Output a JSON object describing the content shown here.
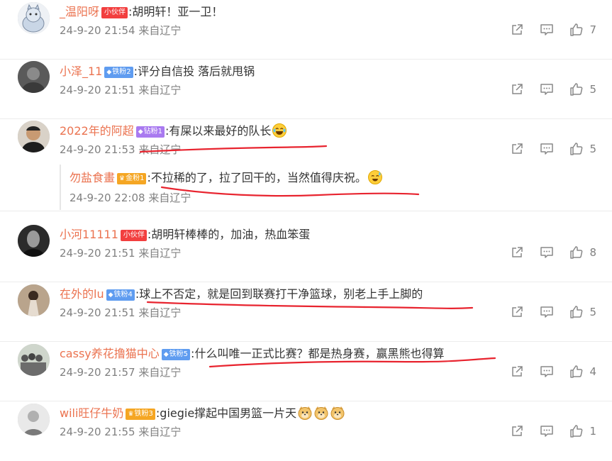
{
  "comments": [
    {
      "username": "_温阳呀",
      "badge": {
        "label": "小伙伴",
        "color": "red",
        "icon": ""
      },
      "text": ":胡明轩！亚一卫！",
      "emojis": [],
      "time": "24-9-20 21:54",
      "location": "来自辽宁",
      "likes": "7",
      "avatar": "cartoon-cat-avatar"
    },
    {
      "username": "小泽_11",
      "badge": {
        "label": "铁粉2",
        "color": "blue",
        "icon": "◆"
      },
      "text": ":评分自信投 落后就甩锅",
      "emojis": [],
      "time": "24-9-20 21:51",
      "location": "来自辽宁",
      "likes": "5",
      "avatar": "photo-avatar"
    },
    {
      "username": "2022年的阿超",
      "badge": {
        "label": "钻粉1",
        "color": "purple",
        "icon": "◆"
      },
      "text": ":有屎以来最好的队长",
      "emojis": [
        "laughing-tears-emoji"
      ],
      "time": "24-9-20 21:53",
      "location": "来自辽宁",
      "likes": "5",
      "avatar": "photo-avatar"
    },
    {
      "username": "小河11111",
      "badge": {
        "label": "小伙伴",
        "color": "red",
        "icon": ""
      },
      "text": ":胡明轩棒棒的，加油，热血笨蛋",
      "emojis": [],
      "time": "24-9-20 21:51",
      "location": "来自辽宁",
      "likes": "8",
      "avatar": "photo-avatar"
    },
    {
      "username": "在外的lu",
      "badge": {
        "label": "铁粉4",
        "color": "blue",
        "icon": "◆"
      },
      "text": ":球上不否定，就是回到联赛打干净篮球，别老上手上脚的",
      "emojis": [],
      "time": "24-9-20 21:51",
      "location": "来自辽宁",
      "likes": "5",
      "avatar": "photo-avatar"
    },
    {
      "username": "cassy养花撸猫中心",
      "badge": {
        "label": "铁粉5",
        "color": "blue",
        "icon": "◆"
      },
      "text": ":什么叫唯一正式比赛？都是热身赛，赢黑熊也得算",
      "emojis": [],
      "time": "24-9-20 21:57",
      "location": "来自辽宁",
      "likes": "4",
      "avatar": "photo-avatar"
    },
    {
      "username": "wili旺仔牛奶",
      "badge": {
        "label": "铁粉3",
        "color": "orange",
        "icon": "♛"
      },
      "text": ":giegie撑起中国男篮一片天",
      "emojis": [
        "doge-emoji",
        "doge-emoji",
        "doge-emoji"
      ],
      "time": "24-9-20 21:55",
      "location": "来自辽宁",
      "likes": "1",
      "avatar": "photo-avatar"
    }
  ],
  "reply": {
    "username": "勿盐食畫",
    "badge": {
      "label": "金粉1",
      "color": "orange",
      "icon": "♛"
    },
    "text": ":不拉稀的了，拉了回干的，当然值得庆祝。",
    "emojis": [
      "sweat-smile-emoji"
    ],
    "time": "24-9-20 22:08",
    "location": "来自辽宁"
  },
  "icons": {
    "share": "share-icon",
    "reply": "comment-icon",
    "like": "thumbs-up-icon"
  },
  "colors": {
    "username": "#eb7350",
    "meta": "#808080",
    "annotation": "#e8242f"
  }
}
